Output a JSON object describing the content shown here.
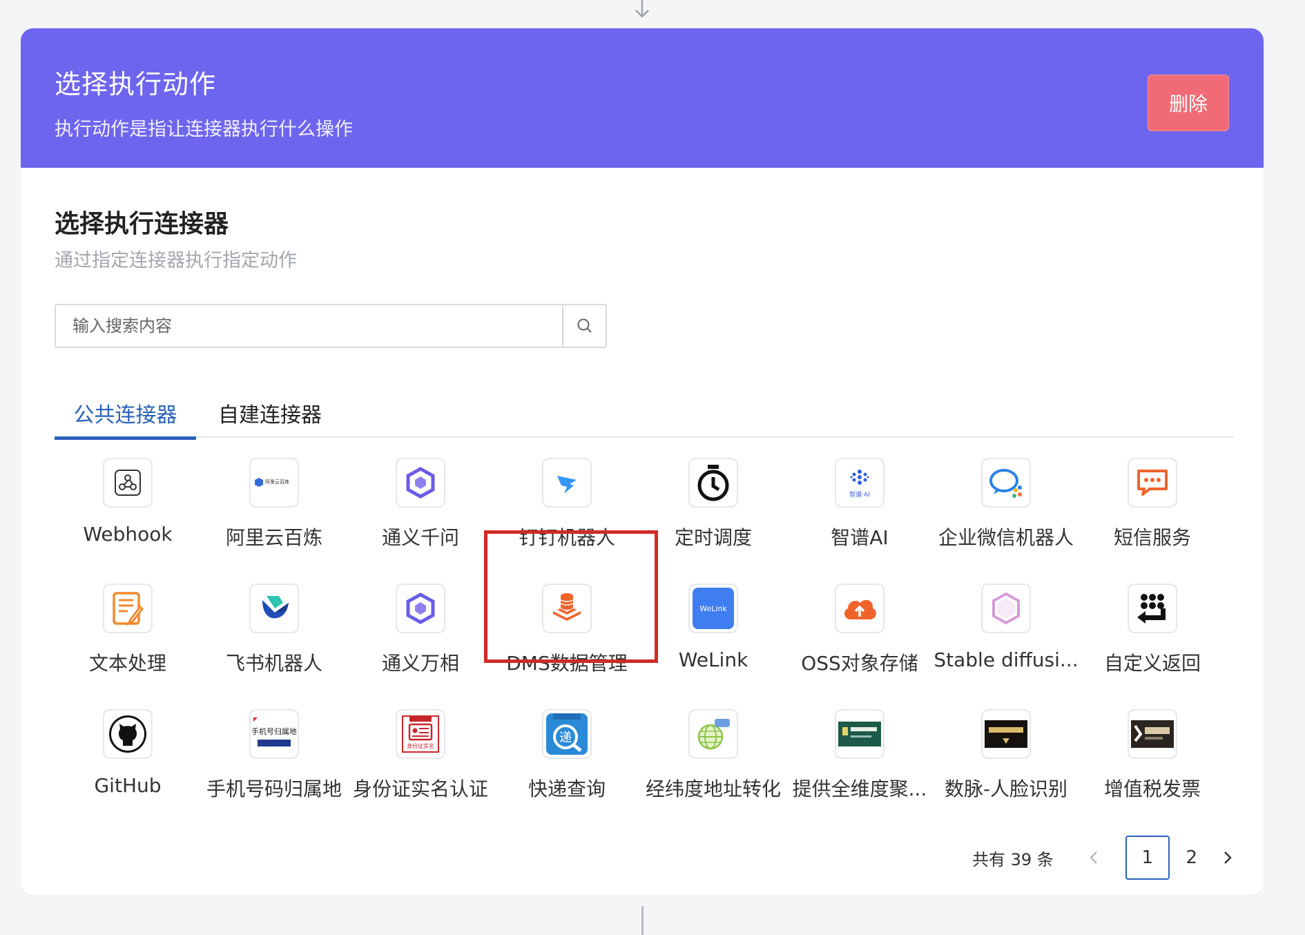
{
  "header": {
    "title": "选择执行动作",
    "subtitle": "执行动作是指让连接器执行什么操作",
    "delete_label": "删除"
  },
  "section": {
    "title": "选择执行连接器",
    "subtitle": "通过指定连接器执行指定动作"
  },
  "search": {
    "placeholder": "输入搜索内容"
  },
  "tabs": [
    {
      "label": "公共连接器",
      "active": true
    },
    {
      "label": "自建连接器",
      "active": false
    }
  ],
  "connectors": [
    {
      "label": "Webhook",
      "icon": "webhook-icon"
    },
    {
      "label": "阿里云百炼",
      "icon": "aliyun-bailian-logo",
      "logo_text": "阿里云百炼"
    },
    {
      "label": "通义千问",
      "icon": "tongyi-qianwen-logo"
    },
    {
      "label": "钉钉机器人",
      "icon": "dingtalk-logo"
    },
    {
      "label": "定时调度",
      "icon": "stopwatch-icon"
    },
    {
      "label": "智谱AI",
      "icon": "zhipu-ai-logo",
      "logo_text": "智谱·AI"
    },
    {
      "label": "企业微信机器人",
      "icon": "wecom-logo"
    },
    {
      "label": "短信服务",
      "icon": "sms-chat-icon"
    },
    {
      "label": "文本处理",
      "icon": "text-edit-icon"
    },
    {
      "label": "飞书机器人",
      "icon": "feishu-logo"
    },
    {
      "label": "通义万相",
      "icon": "tongyi-wanxiang-logo"
    },
    {
      "label": "DMS数据管理",
      "icon": "dms-database-icon"
    },
    {
      "label": "WeLink",
      "icon": "welink-logo",
      "logo_text": "WeLink"
    },
    {
      "label": "OSS对象存储",
      "icon": "oss-cloud-icon"
    },
    {
      "label": "Stable diffusi...",
      "icon": "stable-diffusion-logo"
    },
    {
      "label": "自定义返回",
      "icon": "custom-return-icon"
    },
    {
      "label": "GitHub",
      "icon": "github-icon"
    },
    {
      "label": "手机号码归属地",
      "icon": "phone-location-logo",
      "logo_text": "手机号归属地"
    },
    {
      "label": "身份证实名认证",
      "icon": "id-card-logo",
      "logo_text": "身份证实名"
    },
    {
      "label": "快递查询",
      "icon": "express-query-logo",
      "logo_text": "递"
    },
    {
      "label": "经纬度地址转化",
      "icon": "globe-geo-icon"
    },
    {
      "label": "提供全维度聚...",
      "icon": "data-aggregation-logo"
    },
    {
      "label": "数脉-人脸识别",
      "icon": "face-recognition-logo"
    },
    {
      "label": "增值税发票",
      "icon": "vat-invoice-logo"
    }
  ],
  "pagination": {
    "total_text": "共有 39 条",
    "pages": [
      "1",
      "2"
    ],
    "current": "1"
  },
  "colors": {
    "header_bg": "#6e65ee",
    "delete_btn": "#f06b75",
    "accent": "#2a62b8",
    "highlight_border": "#cf2b25"
  }
}
